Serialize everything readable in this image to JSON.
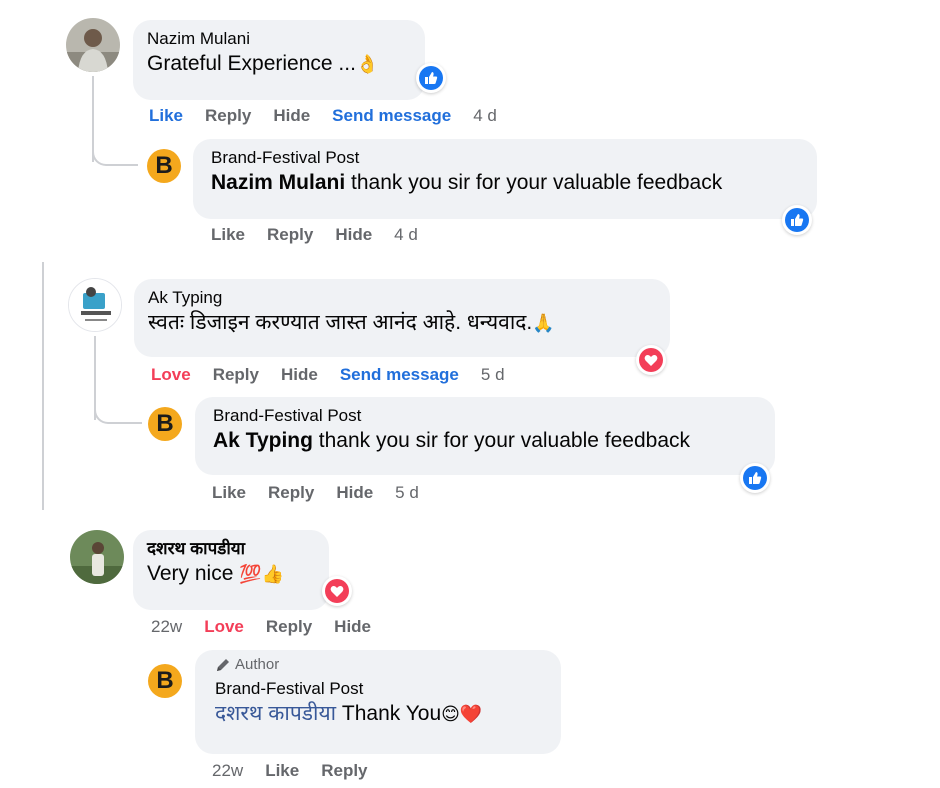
{
  "comments": [
    {
      "author": "Nazim Mulani",
      "text": "Grateful Experience ...",
      "text_emoji": "👌",
      "reaction": "like",
      "actions": {
        "like": "Like",
        "reply": "Reply",
        "hide": "Hide",
        "send": "Send message",
        "time": "4 d"
      },
      "reply": {
        "author": "Brand-Festival Post",
        "mention": "Nazim Mulani",
        "text": " thank you sir for your valuable feedback",
        "reaction": "like",
        "actions": {
          "like": "Like",
          "reply": "Reply",
          "hide": "Hide",
          "time": "4 d"
        }
      }
    },
    {
      "author": "Ak Typing",
      "text": "स्वतः डिजाइन करण्यात जास्त आनंद आहे. धन्यवाद.",
      "text_emoji": "🙏",
      "reaction": "love",
      "actions": {
        "love": "Love",
        "reply": "Reply",
        "hide": "Hide",
        "send": "Send message",
        "time": "5 d"
      },
      "reply": {
        "author": "Brand-Festival Post",
        "mention": "Ak Typing",
        "text": " thank you sir for your valuable feedback",
        "reaction": "like",
        "actions": {
          "like": "Like",
          "reply": "Reply",
          "hide": "Hide",
          "time": "5 d"
        }
      }
    },
    {
      "author": "दशरथ कापडीया",
      "text": "Very nice ",
      "text_emoji": "💯👍",
      "reaction": "love",
      "actions": {
        "time": "22w",
        "love": "Love",
        "reply": "Reply",
        "hide": "Hide"
      },
      "reply": {
        "author_tag": "Author",
        "author": "Brand-Festival Post",
        "mention": "दशरथ कापडीया",
        "text": " Thank You",
        "text_emoji": "😊❤️",
        "actions": {
          "time": "22w",
          "like": "Like",
          "reply": "Reply"
        }
      }
    }
  ],
  "brand_initial": "B",
  "colors": {
    "accent_blue": "#216fdb",
    "love_red": "#f33e58",
    "bubble_bg": "#f0f2f5",
    "muted": "#65676b",
    "brand_avatar": "#f4a81d"
  }
}
